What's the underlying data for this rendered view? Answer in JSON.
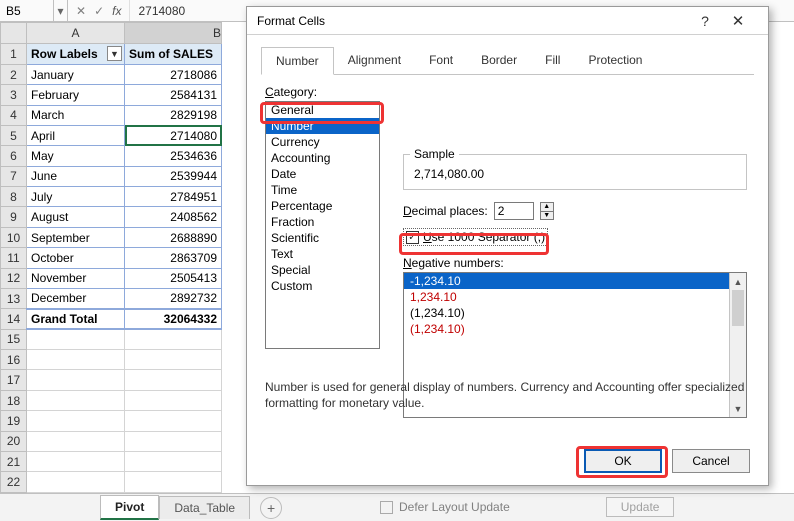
{
  "formula_bar": {
    "name_box": "B5",
    "value": "2714080"
  },
  "columns": [
    "A",
    "B"
  ],
  "pivot_headers": {
    "row_label": "Row Labels",
    "values_label": "Sum of SALES"
  },
  "rows": [
    {
      "label": "January",
      "value": "2718086"
    },
    {
      "label": "February",
      "value": "2584131"
    },
    {
      "label": "March",
      "value": "2829198"
    },
    {
      "label": "April",
      "value": "2714080"
    },
    {
      "label": "May",
      "value": "2534636"
    },
    {
      "label": "June",
      "value": "2539944"
    },
    {
      "label": "July",
      "value": "2784951"
    },
    {
      "label": "August",
      "value": "2408562"
    },
    {
      "label": "September",
      "value": "2688890"
    },
    {
      "label": "October",
      "value": "2863709"
    },
    {
      "label": "November",
      "value": "2505413"
    },
    {
      "label": "December",
      "value": "2892732"
    }
  ],
  "grand_total": {
    "label": "Grand Total",
    "value": "32064332"
  },
  "sheet_tabs": {
    "active": "Pivot",
    "other": "Data_Table"
  },
  "dialog": {
    "title": "Format Cells",
    "tabs": [
      "Number",
      "Alignment",
      "Font",
      "Border",
      "Fill",
      "Protection"
    ],
    "category_label": "Category:",
    "categories": [
      "General",
      "Number",
      "Currency",
      "Accounting",
      "Date",
      "Time",
      "Percentage",
      "Fraction",
      "Scientific",
      "Text",
      "Special",
      "Custom"
    ],
    "sample_label": "Sample",
    "sample_value": "2,714,080.00",
    "decimal_label": "Decimal places:",
    "decimal_value": "2",
    "separator_label": "Use 1000 Separator (,)",
    "negative_label": "Negative numbers:",
    "negative_options": [
      "-1,234.10",
      "1,234.10",
      "(1,234.10)",
      "(1,234.10)"
    ],
    "description": "Number is used for general display of numbers.  Currency and Accounting offer specialized formatting for monetary value.",
    "ok": "OK",
    "cancel": "Cancel"
  },
  "defer": {
    "label": "Defer Layout Update",
    "button": "Update"
  }
}
